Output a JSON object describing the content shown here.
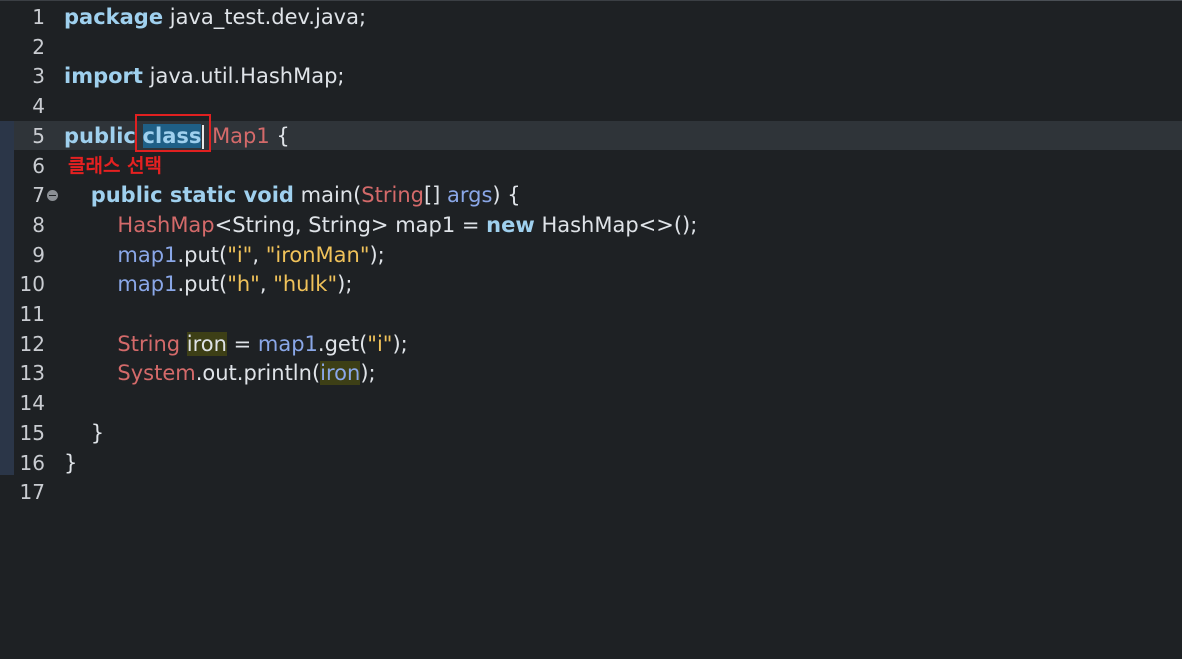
{
  "editor": {
    "lines": [
      {
        "num": "1",
        "tokens": [
          {
            "t": "package",
            "c": "kw"
          },
          {
            "t": " java_test.dev.java;",
            "c": "plain"
          }
        ]
      },
      {
        "num": "2",
        "tokens": []
      },
      {
        "num": "3",
        "tokens": [
          {
            "t": "import",
            "c": "kw"
          },
          {
            "t": " java.util.HashMap;",
            "c": "plain"
          }
        ]
      },
      {
        "num": "4",
        "tokens": []
      },
      {
        "num": "5",
        "current": true,
        "tokens": [
          {
            "t": "public",
            "c": "kw"
          },
          {
            "t": " ",
            "c": "plain"
          },
          {
            "t": "class",
            "c": "sel"
          },
          {
            "cursor": true
          },
          {
            "t": " ",
            "c": "plain"
          },
          {
            "t": "Map1",
            "c": "type"
          },
          {
            "t": " {",
            "c": "plain"
          }
        ]
      },
      {
        "num": "6",
        "tokens": []
      },
      {
        "num": "7",
        "fold": true,
        "tokens": [
          {
            "t": "    ",
            "c": "plain"
          },
          {
            "t": "public static void",
            "c": "kw"
          },
          {
            "t": " main(",
            "c": "plain"
          },
          {
            "t": "String",
            "c": "type"
          },
          {
            "t": "[] ",
            "c": "plain"
          },
          {
            "t": "args",
            "c": "var"
          },
          {
            "t": ") {",
            "c": "plain"
          }
        ]
      },
      {
        "num": "8",
        "tokens": [
          {
            "t": "        ",
            "c": "plain"
          },
          {
            "t": "HashMap",
            "c": "type"
          },
          {
            "t": "<String, String> map1 = ",
            "c": "plain"
          },
          {
            "t": "new",
            "c": "kw"
          },
          {
            "t": " HashMap<>();",
            "c": "plain"
          }
        ]
      },
      {
        "num": "9",
        "tokens": [
          {
            "t": "        ",
            "c": "plain"
          },
          {
            "t": "map1",
            "c": "var"
          },
          {
            "t": ".put(",
            "c": "plain"
          },
          {
            "t": "\"i\"",
            "c": "str"
          },
          {
            "t": ", ",
            "c": "plain"
          },
          {
            "t": "\"ironMan\"",
            "c": "str"
          },
          {
            "t": ");",
            "c": "plain"
          }
        ]
      },
      {
        "num": "10",
        "tokens": [
          {
            "t": "        ",
            "c": "plain"
          },
          {
            "t": "map1",
            "c": "var"
          },
          {
            "t": ".put(",
            "c": "plain"
          },
          {
            "t": "\"h\"",
            "c": "str"
          },
          {
            "t": ", ",
            "c": "plain"
          },
          {
            "t": "\"hulk\"",
            "c": "str"
          },
          {
            "t": ");",
            "c": "plain"
          }
        ]
      },
      {
        "num": "11",
        "tokens": []
      },
      {
        "num": "12",
        "tokens": [
          {
            "t": "        ",
            "c": "plain"
          },
          {
            "t": "String",
            "c": "type"
          },
          {
            "t": " ",
            "c": "plain"
          },
          {
            "t": "iron",
            "c": "occ"
          },
          {
            "t": " = ",
            "c": "plain"
          },
          {
            "t": "map1",
            "c": "var"
          },
          {
            "t": ".get(",
            "c": "plain"
          },
          {
            "t": "\"i\"",
            "c": "str"
          },
          {
            "t": ");",
            "c": "plain"
          }
        ]
      },
      {
        "num": "13",
        "tokens": [
          {
            "t": "        ",
            "c": "plain"
          },
          {
            "t": "System",
            "c": "type"
          },
          {
            "t": ".out.println(",
            "c": "plain"
          },
          {
            "t": "iron",
            "c": "occ-var"
          },
          {
            "t": ");",
            "c": "plain"
          }
        ]
      },
      {
        "num": "14",
        "tokens": []
      },
      {
        "num": "15",
        "tokens": [
          {
            "t": "    }",
            "c": "plain"
          }
        ]
      },
      {
        "num": "16",
        "tokens": [
          {
            "t": "}",
            "c": "plain"
          }
        ]
      },
      {
        "num": "17",
        "tokens": []
      }
    ]
  },
  "annotation": {
    "label": "클래스 선택",
    "color": "#e52121"
  }
}
